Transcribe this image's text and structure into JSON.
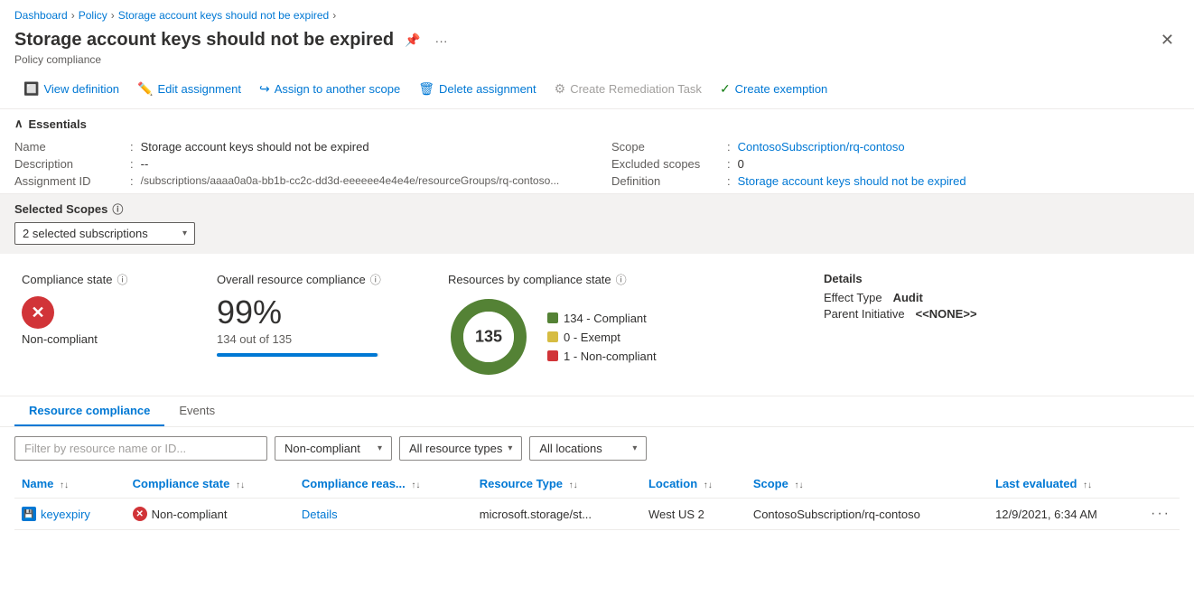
{
  "breadcrumb": {
    "items": [
      "Dashboard",
      "Policy",
      "Storage account keys should not be expired"
    ]
  },
  "header": {
    "title": "Storage account keys should not be expired",
    "subtitle": "Policy compliance"
  },
  "toolbar": {
    "view_definition": "View definition",
    "edit_assignment": "Edit assignment",
    "assign_to_scope": "Assign to another scope",
    "delete_assignment": "Delete assignment",
    "create_remediation": "Create Remediation Task",
    "create_exemption": "Create exemption"
  },
  "essentials": {
    "title": "Essentials",
    "name_label": "Name",
    "name_value": "Storage account keys should not be expired",
    "description_label": "Description",
    "description_value": "--",
    "assignment_id_label": "Assignment ID",
    "assignment_id_value": "/subscriptions/aaaa0a0a-bb1b-cc2c-dd3d-eeeeee4e4e4e/resourceGroups/rq-contoso...",
    "scope_label": "Scope",
    "scope_value": "ContosoSubscription/rq-contoso",
    "excluded_scopes_label": "Excluded scopes",
    "excluded_scopes_value": "0",
    "definition_label": "Definition",
    "definition_value": "Storage account keys should not be expired"
  },
  "selected_scopes": {
    "label": "Selected Scopes",
    "dropdown_value": "2 selected subscriptions"
  },
  "metrics": {
    "compliance_state": {
      "label": "Compliance state",
      "value": "Non-compliant"
    },
    "overall_resource": {
      "label": "Overall resource compliance",
      "percentage": "99%",
      "sub": "134 out of 135",
      "progress": 99
    },
    "resources_by_state": {
      "label": "Resources by compliance state",
      "total": "135",
      "compliant": 134,
      "exempt": 0,
      "noncompliant": 1,
      "legend": [
        {
          "label": "134 - Compliant",
          "color": "#548235"
        },
        {
          "label": "0 - Exempt",
          "color": "#d6bc42"
        },
        {
          "label": "1 - Non-compliant",
          "color": "#d13438"
        }
      ]
    },
    "details": {
      "title": "Details",
      "effect_type_label": "Effect Type",
      "effect_type_value": "Audit",
      "parent_initiative_label": "Parent Initiative",
      "parent_initiative_value": "<<NONE>>"
    }
  },
  "tabs": {
    "resource_compliance": "Resource compliance",
    "events": "Events"
  },
  "filters": {
    "search_placeholder": "Filter by resource name or ID...",
    "compliance_state": "Non-compliant",
    "resource_types": "All resource types",
    "locations": "All locations"
  },
  "table": {
    "headers": [
      "Name",
      "Compliance state",
      "Compliance reas...",
      "Resource Type",
      "Location",
      "Scope",
      "Last evaluated"
    ],
    "rows": [
      {
        "name": "keyexpiry",
        "compliance_state": "Non-compliant",
        "compliance_reason": "Details",
        "resource_type": "microsoft.storage/st...",
        "location": "West US 2",
        "scope": "ContosoSubscription/rq-contoso",
        "last_evaluated": "12/9/2021, 6:34 AM"
      }
    ]
  }
}
